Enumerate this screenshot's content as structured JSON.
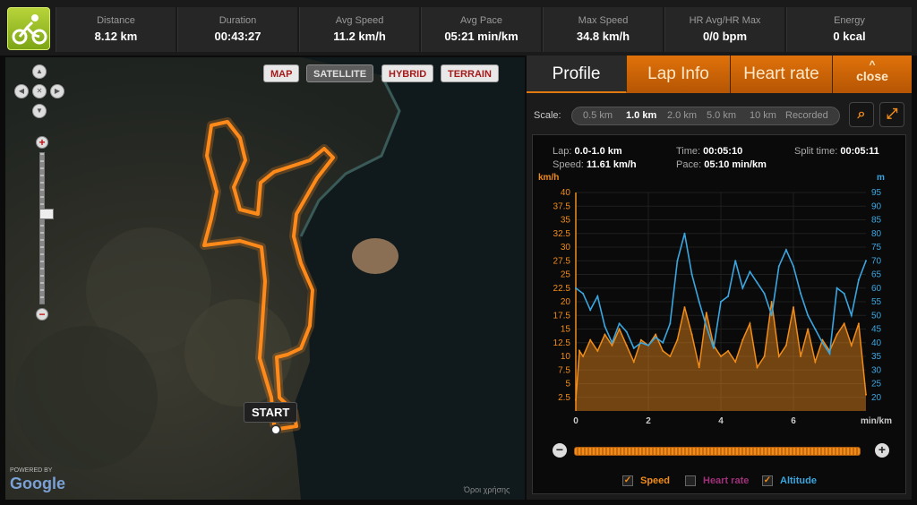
{
  "stats": [
    {
      "label": "Distance",
      "value": "8.12 km"
    },
    {
      "label": "Duration",
      "value": "00:43:27"
    },
    {
      "label": "Avg Speed",
      "value": "11.2 km/h"
    },
    {
      "label": "Avg Pace",
      "value": "05:21 min/km"
    },
    {
      "label": "Max Speed",
      "value": "34.8 km/h"
    },
    {
      "label": "HR Avg/HR Max",
      "value": "0/0 bpm"
    },
    {
      "label": "Energy",
      "value": "0 kcal"
    }
  ],
  "map": {
    "types": [
      "MAP",
      "SATELLITE",
      "HYBRID",
      "TERRAIN"
    ],
    "active_type": "SATELLITE",
    "start_label": "START",
    "powered_by": "POWERED BY",
    "google": "Google",
    "copyright": "Όροι χρήσης",
    "route_color": "#f07c12"
  },
  "panel": {
    "tabs": [
      "Profile",
      "Lap Info",
      "Heart rate"
    ],
    "active_tab": "Profile",
    "close_label": "close",
    "scale_label": "Scale:",
    "scale_options": [
      "0.5 km",
      "1.0 km",
      "2.0 km",
      "5.0 km",
      "10 km",
      "Recorded"
    ],
    "selected_scale": "1.0 km",
    "info": {
      "lap_label": "Lap:",
      "lap_value": "0.0-1.0 km",
      "speed_label": "Speed:",
      "speed_value": "11.61 km/h",
      "time_label": "Time:",
      "time_value": "00:05:10",
      "pace_label": "Pace:",
      "pace_value": "05:10 min/km",
      "split_label": "Split time:",
      "split_value": "00:05:11"
    },
    "legend": [
      {
        "label": "Speed",
        "checked": true,
        "color": "#f08c1a"
      },
      {
        "label": "Heart rate",
        "checked": false,
        "color": "#a0307a"
      },
      {
        "label": "Altitude",
        "checked": true,
        "color": "#3aa6e0"
      }
    ]
  },
  "chart_data": {
    "type": "line",
    "left_axis": {
      "label": "km/h",
      "range": [
        0,
        40
      ],
      "ticks": [
        "40",
        "37.5",
        "35",
        "32.5",
        "30",
        "27.5",
        "25",
        "22.5",
        "20",
        "17.5",
        "15",
        "12.5",
        "10",
        "7.5",
        "5",
        "2.5"
      ]
    },
    "right_axis": {
      "label": "m",
      "range": [
        15,
        95
      ],
      "ticks": [
        "95",
        "90",
        "85",
        "80",
        "75",
        "70",
        "65",
        "60",
        "55",
        "50",
        "45",
        "40",
        "35",
        "30",
        "25",
        "20"
      ]
    },
    "x_axis": {
      "label": "min/km",
      "range": [
        0,
        8
      ],
      "ticks": [
        "0",
        "2",
        "4",
        "6"
      ]
    },
    "series": [
      {
        "name": "Speed",
        "x": [
          0,
          0.1,
          0.2,
          0.4,
          0.6,
          0.8,
          1.0,
          1.2,
          1.4,
          1.6,
          1.8,
          2.0,
          2.2,
          2.4,
          2.6,
          2.8,
          3.0,
          3.2,
          3.4,
          3.6,
          3.8,
          4.0,
          4.2,
          4.4,
          4.6,
          4.8,
          5.0,
          5.2,
          5.4,
          5.6,
          5.8,
          6.0,
          6.2,
          6.4,
          6.6,
          6.8,
          7.0,
          7.2,
          7.4,
          7.6,
          7.8,
          8.0
        ],
        "y": [
          2,
          11,
          10,
          13,
          11,
          14,
          12,
          15,
          12,
          9,
          13,
          12,
          14,
          11,
          10,
          13,
          19,
          14,
          8,
          18,
          12,
          10,
          11,
          9,
          13,
          16,
          8,
          10,
          20,
          10,
          12,
          19,
          10,
          15,
          9,
          13,
          11,
          14,
          16,
          12,
          16,
          3
        ]
      },
      {
        "name": "Altitude",
        "x": [
          0,
          0.2,
          0.4,
          0.6,
          0.8,
          1.0,
          1.2,
          1.4,
          1.6,
          1.8,
          2.0,
          2.2,
          2.4,
          2.6,
          2.8,
          3.0,
          3.2,
          3.4,
          3.6,
          3.8,
          4.0,
          4.2,
          4.4,
          4.6,
          4.8,
          5.0,
          5.2,
          5.4,
          5.6,
          5.8,
          6.0,
          6.2,
          6.4,
          6.6,
          6.8,
          7.0,
          7.2,
          7.4,
          7.6,
          7.8,
          8.0
        ],
        "y": [
          60,
          58,
          52,
          57,
          46,
          40,
          47,
          44,
          38,
          40,
          39,
          42,
          40,
          47,
          70,
          80,
          65,
          55,
          46,
          38,
          55,
          57,
          70,
          60,
          66,
          62,
          58,
          50,
          68,
          74,
          68,
          58,
          50,
          45,
          40,
          36,
          60,
          58,
          50,
          63,
          70
        ]
      }
    ]
  }
}
